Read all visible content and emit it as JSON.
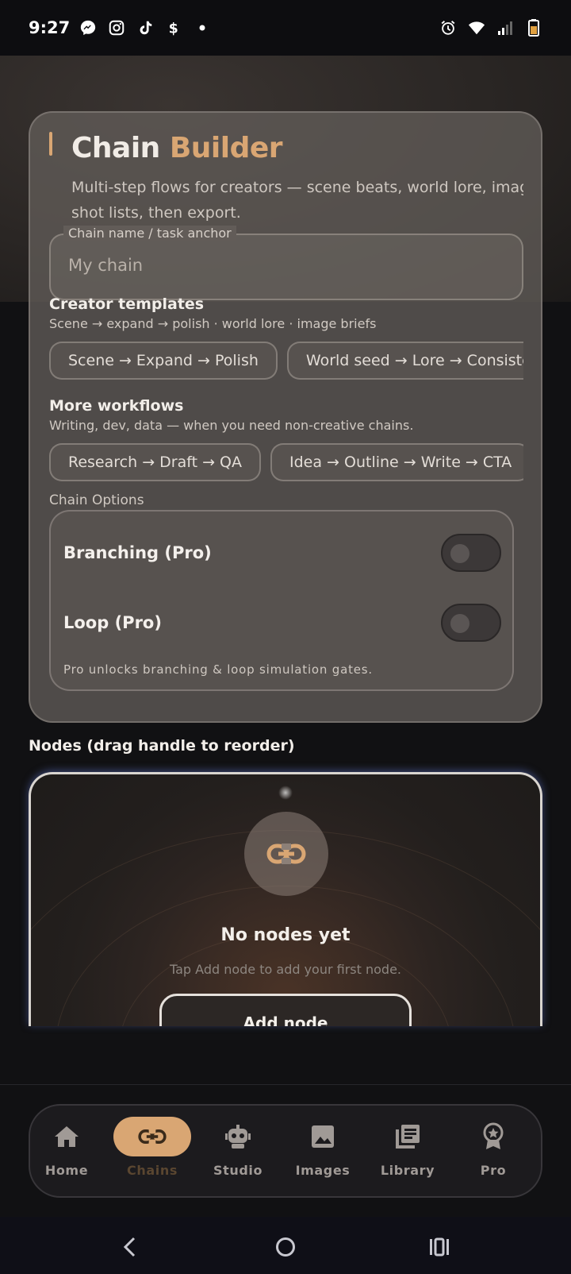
{
  "status_bar": {
    "time": "9:27",
    "left_icons": [
      "messenger-icon",
      "instagram-icon",
      "tiktok-icon",
      "cashapp-icon",
      "dot-icon"
    ],
    "right_icons": [
      "alarm-icon",
      "wifi-icon",
      "signal-icon",
      "battery-icon"
    ]
  },
  "card": {
    "title_part1": "Chain",
    "title_part2": "Builder",
    "subtitle_line1": "Multi-step flows for creators — scene beats, world lore, image",
    "subtitle_line2": "shot lists, then export.",
    "chain_name": {
      "label": "Chain name / task anchor",
      "placeholder": "My chain"
    },
    "creator_templates": {
      "title": "Creator templates",
      "subtitle": "Scene → expand → polish · world lore · image briefs",
      "chips": [
        "Scene → Expand → Polish",
        "World seed → Lore → Consistency"
      ]
    },
    "more_workflows": {
      "title": "More workflows",
      "subtitle": "Writing, dev, data — when you need non-creative chains.",
      "chips": [
        "Research → Draft → QA",
        "Idea → Outline → Write → CTA"
      ]
    },
    "options": {
      "label": "Chain Options",
      "branching_label": "Branching (Pro)",
      "branching_on": false,
      "loop_label": "Loop (Pro)",
      "loop_on": false,
      "note": "Pro unlocks branching & loop simulation gates."
    }
  },
  "nodes": {
    "title": "Nodes (drag handle to reorder)",
    "empty_title": "No nodes yet",
    "empty_subtitle": "Tap Add node to add your first node.",
    "add_button": "Add node"
  },
  "bottom_nav": {
    "active": "Chains",
    "items": [
      {
        "label": "Home",
        "icon": "home-icon"
      },
      {
        "label": "Chains",
        "icon": "link-icon"
      },
      {
        "label": "Studio",
        "icon": "robot-icon"
      },
      {
        "label": "Images",
        "icon": "image-icon"
      },
      {
        "label": "Library",
        "icon": "library-icon"
      },
      {
        "label": "Pro",
        "icon": "award-icon"
      }
    ]
  },
  "colors": {
    "accent": "#d9a673",
    "card_bg": "#625c58",
    "nav_bg": "#1c1b1e",
    "screen_bg": "#111113"
  }
}
